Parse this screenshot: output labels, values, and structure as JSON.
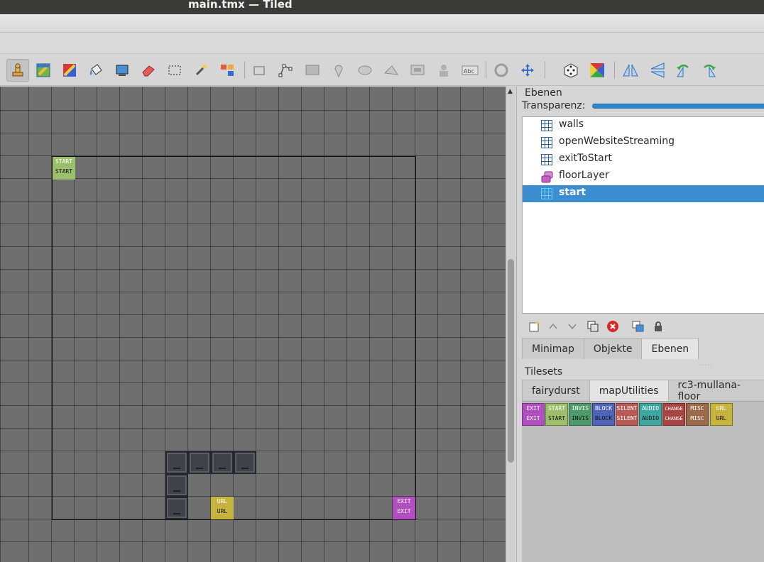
{
  "window": {
    "title": "main.tmx — Tiled"
  },
  "toolbar": {
    "tools": [
      {
        "name": "stamp-brush-icon",
        "active": true
      },
      {
        "name": "terrain-brush-icon"
      },
      {
        "name": "wang-brush-icon"
      },
      {
        "name": "bucket-fill-icon"
      },
      {
        "name": "shape-fill-icon"
      },
      {
        "name": "eraser-icon"
      },
      {
        "name": "rectangular-select-icon"
      },
      {
        "name": "magic-wand-icon"
      },
      {
        "name": "select-same-tile-icon"
      },
      {
        "name": "select-objects-icon"
      },
      {
        "name": "edit-polygons-icon"
      },
      {
        "name": "insert-rectangle-icon"
      },
      {
        "name": "insert-point-icon"
      },
      {
        "name": "insert-ellipse-icon"
      },
      {
        "name": "insert-polygon-icon"
      },
      {
        "name": "insert-tile-icon"
      },
      {
        "name": "insert-template-icon"
      },
      {
        "name": "insert-text-icon"
      },
      {
        "name": "layer-offset-icon"
      },
      {
        "name": "move-icon"
      },
      {
        "name": "random-mode-icon"
      },
      {
        "name": "wang-fill-mode-icon"
      },
      {
        "name": "flip-horizontal-icon"
      },
      {
        "name": "flip-vertical-icon"
      },
      {
        "name": "rotate-left-icon"
      },
      {
        "name": "rotate-right-icon"
      }
    ]
  },
  "map": {
    "tiles": [
      {
        "kind": "START",
        "line1": "START",
        "line2": "START",
        "color": "#9bbf6a"
      },
      {
        "kind": "URL",
        "line1": "URL",
        "line2": "URL",
        "color": "#c7b43f"
      },
      {
        "kind": "EXIT",
        "line1": "EXIT",
        "line2": "EXIT",
        "color": "#b14fc0"
      }
    ]
  },
  "layers_panel": {
    "title": "Ebenen",
    "opacity_label": "Transparenz:",
    "opacity": 1.0,
    "layers": [
      {
        "name": "walls",
        "icon": "tile-layer-icon",
        "selected": false
      },
      {
        "name": "openWebsiteStreaming",
        "icon": "tile-layer-icon",
        "selected": false
      },
      {
        "name": "exitToStart",
        "icon": "tile-layer-icon",
        "selected": false
      },
      {
        "name": "floorLayer",
        "icon": "group-layer-icon",
        "selected": false
      },
      {
        "name": "start",
        "icon": "tile-layer-icon",
        "selected": true
      }
    ]
  },
  "dock_tabs": [
    {
      "label": "Minimap",
      "active": false
    },
    {
      "label": "Objekte",
      "active": false
    },
    {
      "label": "Ebenen",
      "active": true
    }
  ],
  "tilesets_panel": {
    "title": "Tilesets",
    "tabs": [
      {
        "label": "fairydurst",
        "active": false
      },
      {
        "label": "mapUtilities",
        "active": true
      },
      {
        "label": "rc3-mullana-floor",
        "active": false
      }
    ],
    "tiles": [
      {
        "line1": "EXIT",
        "line2": "EXIT",
        "color": "#b14fc0"
      },
      {
        "line1": "START",
        "line2": "START",
        "color": "#9bbf6a"
      },
      {
        "line1": "INVIS",
        "line2": "INVIS",
        "color": "#4f9a6a"
      },
      {
        "line1": "BLOCK",
        "line2": "BLOCK",
        "color": "#4f63b8"
      },
      {
        "line1": "SILENT",
        "line2": "SILENT",
        "color": "#b85a55"
      },
      {
        "line1": "AUDIO",
        "line2": "AUDIO",
        "color": "#3fa7a0"
      },
      {
        "line1": "CHANGE",
        "line2": "CHANGE",
        "color": "#a84444"
      },
      {
        "line1": "MISC",
        "line2": "MISC",
        "color": "#9a6a4a"
      },
      {
        "line1": "URL",
        "line2": "URL",
        "color": "#c7b43f"
      }
    ]
  }
}
